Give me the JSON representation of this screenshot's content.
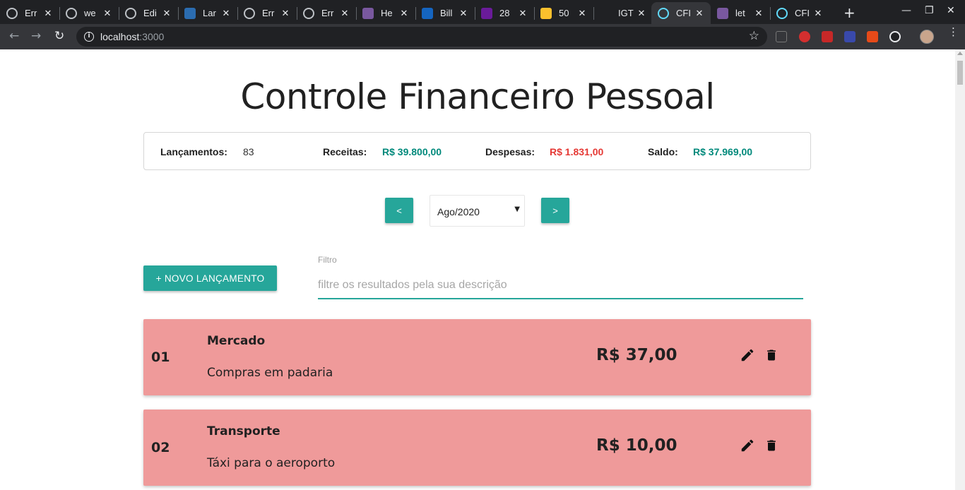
{
  "browser": {
    "tabs": [
      {
        "title": "Err",
        "icon": "github-icon",
        "color": "#3a3a3a"
      },
      {
        "title": "we",
        "icon": "github-icon",
        "color": "#3a3a3a"
      },
      {
        "title": "Edi",
        "icon": "github-icon",
        "color": "#3a3a3a"
      },
      {
        "title": "Lar",
        "icon": "laravel-icon",
        "color": "#2b6cb0"
      },
      {
        "title": "Err",
        "icon": "github-icon",
        "color": "#3a3a3a"
      },
      {
        "title": "Err",
        "icon": "github-icon",
        "color": "#3a3a3a"
      },
      {
        "title": "He",
        "icon": "heroku-icon",
        "color": "#79589f"
      },
      {
        "title": "Bill",
        "icon": "fe-icon",
        "color": "#1565c0"
      },
      {
        "title": "28",
        "icon": "circle-icon",
        "color": "#6a1b9a"
      },
      {
        "title": "50",
        "icon": "flag-icon",
        "color": "#fbc02d"
      },
      {
        "title": "IGT",
        "icon": "igti-icon",
        "color": "#202124"
      },
      {
        "title": "CFI",
        "icon": "react-icon",
        "color": "#35363a",
        "active": true
      },
      {
        "title": "let",
        "icon": "heroku-icon",
        "color": "#79589f"
      },
      {
        "title": "CFI",
        "icon": "react-icon",
        "color": "#202124"
      }
    ],
    "url_host": "localhost",
    "url_port": ":3000"
  },
  "page": {
    "title": "Controle Financeiro Pessoal",
    "summary": {
      "entries_label": "Lançamentos:",
      "entries_value": "83",
      "income_label": "Receitas:",
      "income_value": "R$ 39.800,00",
      "expense_label": "Despesas:",
      "expense_value": "R$ 1.831,00",
      "balance_label": "Saldo:",
      "balance_value": "R$ 37.969,00"
    },
    "period": {
      "prev_label": "<",
      "next_label": ">",
      "selected": "Ago/2020"
    },
    "add_button": "+ NOVO LANÇAMENTO",
    "filter": {
      "label": "Filtro",
      "placeholder": "filtre os resultados pela sua descrição",
      "value": ""
    },
    "entries": [
      {
        "num": "01",
        "category": "Mercado",
        "description": "Compras em padaria",
        "amount": "R$ 37,00"
      },
      {
        "num": "02",
        "category": "Transporte",
        "description": "Táxi para o aeroporto",
        "amount": "R$ 10,00"
      }
    ]
  },
  "colors": {
    "accent": "#26a69a",
    "expense_row": "#ef9a9a",
    "income_text": "#00897b",
    "expense_text": "#e53935"
  }
}
